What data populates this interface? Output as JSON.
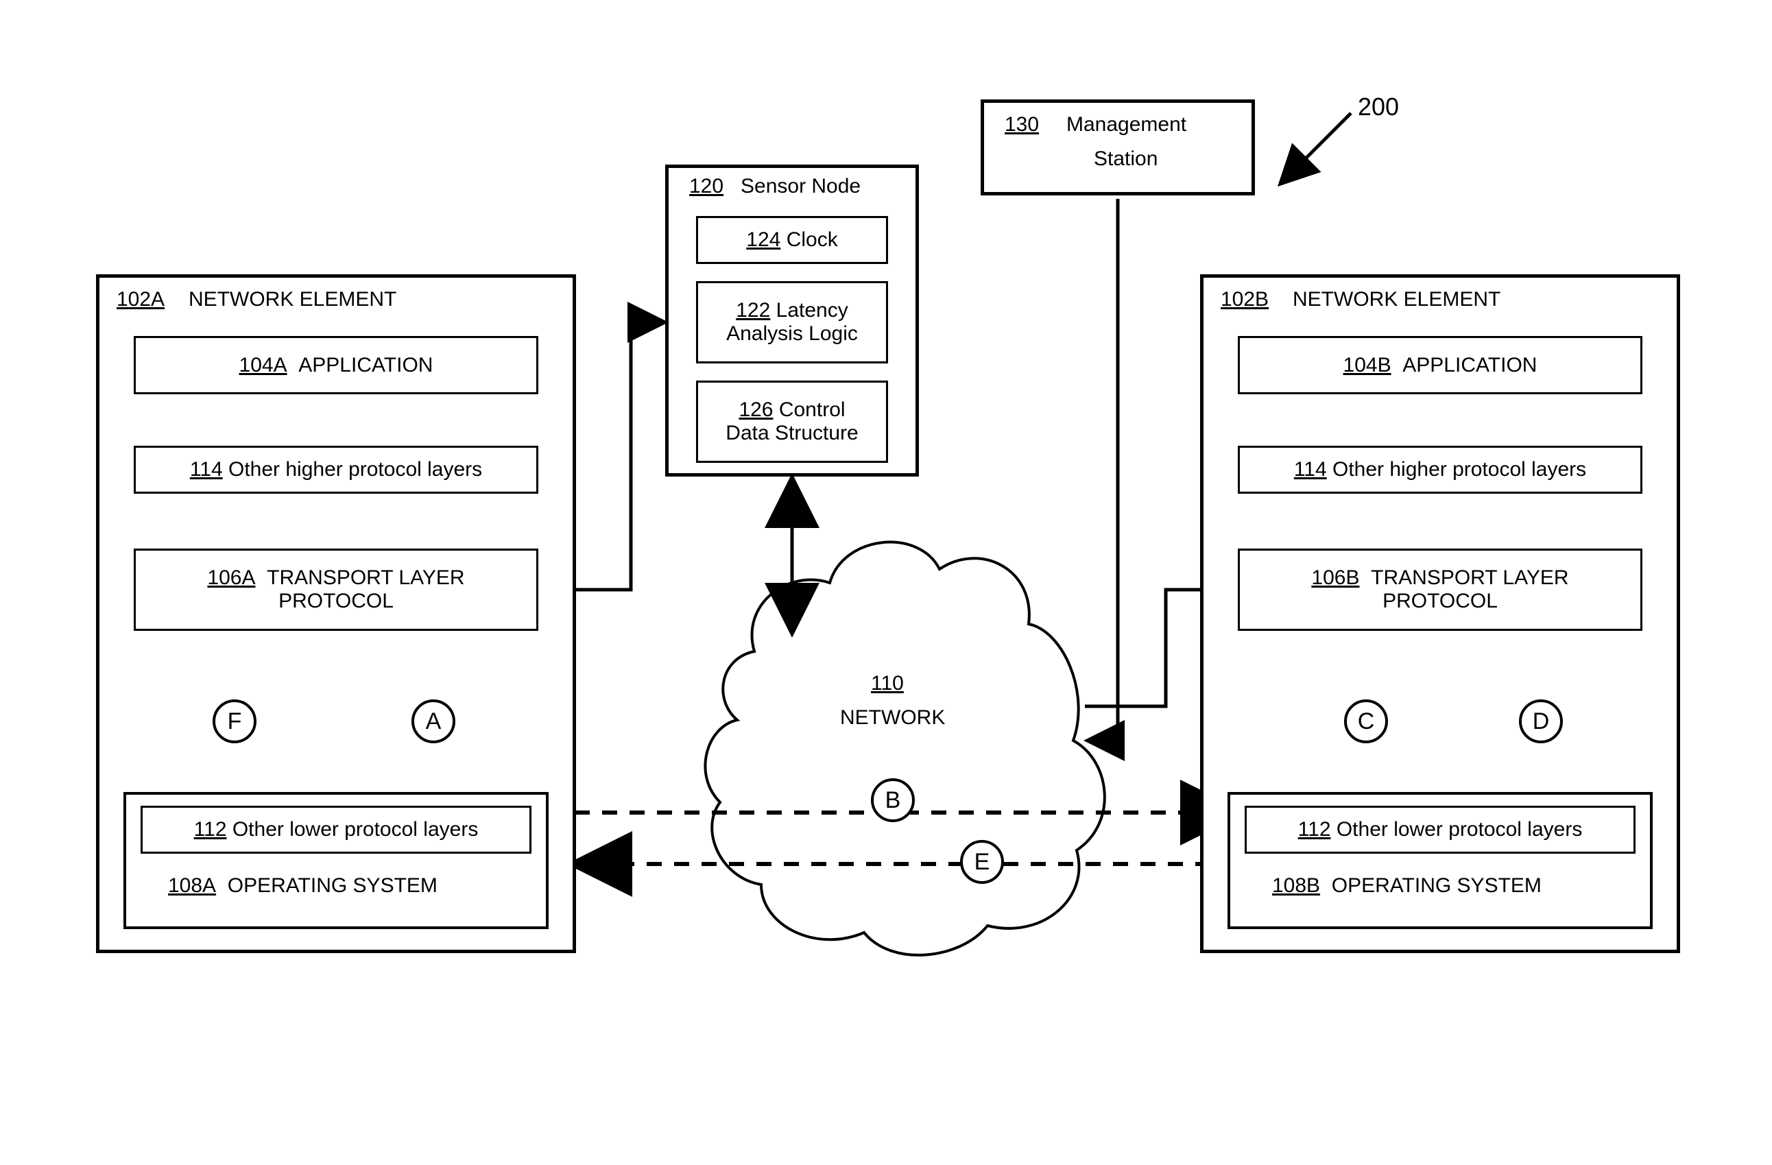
{
  "figureNumber": "200",
  "mgmtStation": {
    "ref": "130",
    "label": "Management Station"
  },
  "sensorNode": {
    "ref": "120",
    "label": "Sensor Node",
    "clock": {
      "ref": "124",
      "label": "Clock"
    },
    "latency": {
      "ref": "122",
      "label": "Latency Analysis Logic"
    },
    "control": {
      "ref": "126",
      "label": "Control Data Structure"
    }
  },
  "network": {
    "ref": "110",
    "label": "NETWORK"
  },
  "elemA": {
    "ref": "102A",
    "label": "NETWORK ELEMENT",
    "app": {
      "ref": "104A",
      "label": "APPLICATION"
    },
    "higher": {
      "ref": "114",
      "label": "Other higher protocol layers"
    },
    "transport": {
      "ref": "106A",
      "label": "TRANSPORT LAYER PROTOCOL"
    },
    "lower": {
      "ref": "112",
      "label": "Other lower protocol layers"
    },
    "os": {
      "ref": "108A",
      "label": "OPERATING SYSTEM"
    }
  },
  "elemB": {
    "ref": "102B",
    "label": "NETWORK ELEMENT",
    "app": {
      "ref": "104B",
      "label": "APPLICATION"
    },
    "higher": {
      "ref": "114",
      "label": "Other higher protocol layers"
    },
    "transport": {
      "ref": "106B",
      "label": "TRANSPORT LAYER PROTOCOL"
    },
    "lower": {
      "ref": "112",
      "label": "Other lower protocol layers"
    },
    "os": {
      "ref": "108B",
      "label": "OPERATING SYSTEM"
    }
  },
  "markers": {
    "A": "A",
    "B": "B",
    "C": "C",
    "D": "D",
    "E": "E",
    "F": "F"
  }
}
